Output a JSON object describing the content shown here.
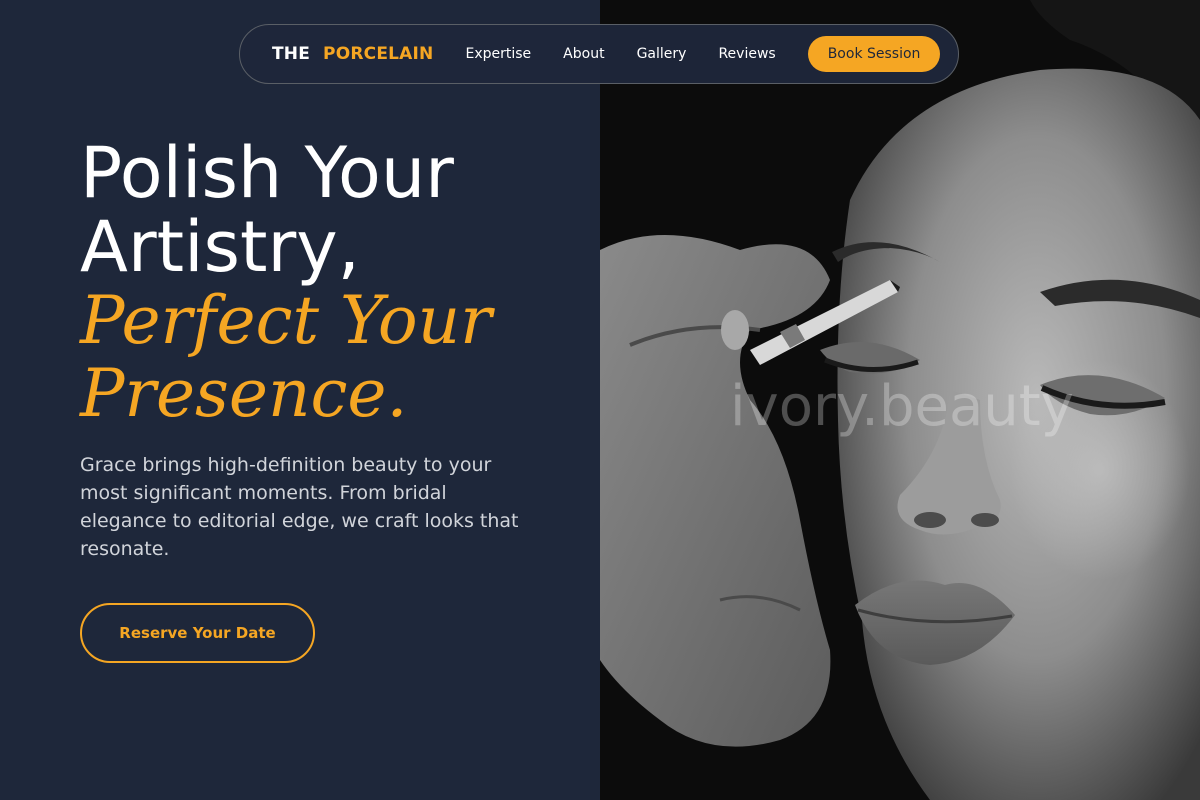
{
  "brand": {
    "prefix": "THE",
    "name": "PORCELAIN"
  },
  "nav": {
    "links": [
      "Expertise",
      "About",
      "Gallery",
      "Reviews"
    ],
    "cta_label": "Book Session"
  },
  "hero": {
    "title_line1": "Polish Your",
    "title_line2": "Artistry,",
    "accent_line1": "Perfect Your",
    "accent_line2": "Presence.",
    "description": "Grace brings high-definition beauty to your most significant moments. From bridal elegance to editorial edge, we craft looks that resonate.",
    "cta_label": "Reserve Your Date"
  },
  "photo": {
    "watermark": "ivory.beauty",
    "alt_subject": "makeup artist applying eyeliner to woman"
  },
  "colors": {
    "background": "#1e273a",
    "accent": "#f5a623",
    "text_primary": "#ffffff",
    "text_muted": "#d1d4da"
  },
  "icons": {
    "photo": "portrait-photo"
  }
}
